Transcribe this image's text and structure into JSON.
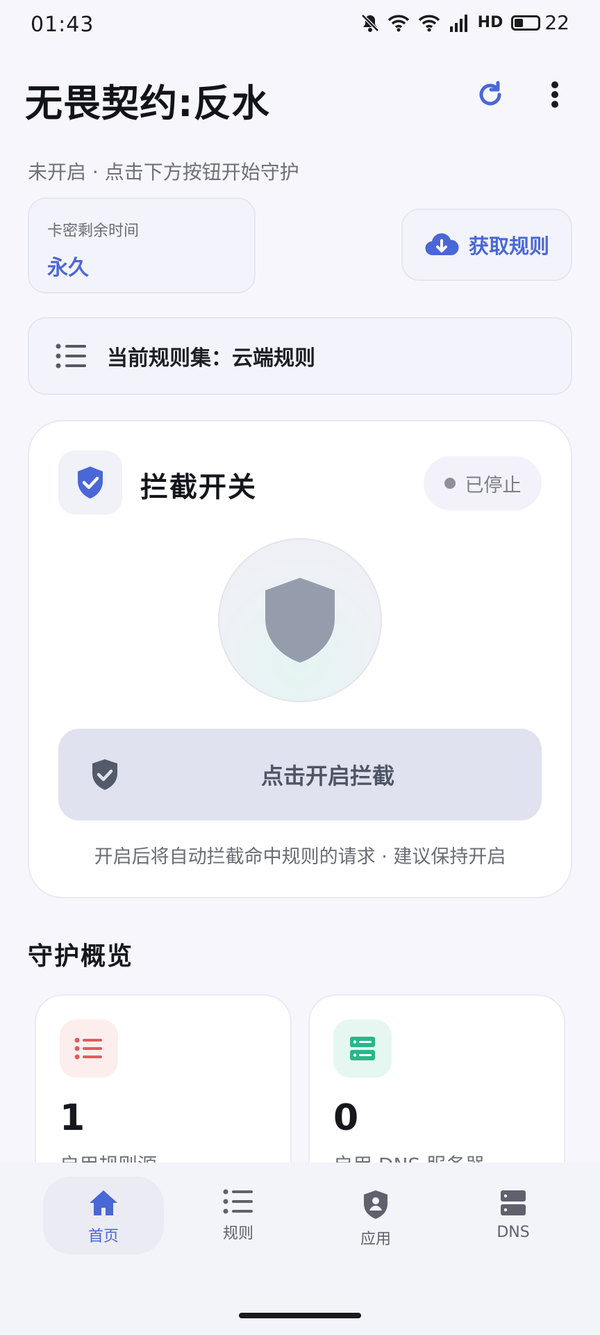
{
  "status_bar": {
    "time": "01:43",
    "network_label": "HD",
    "battery_level": "22"
  },
  "header": {
    "title": "无畏契约:反水",
    "subtitle": "未开启 · 点击下方按钮开始守护"
  },
  "key_card": {
    "label": "卡密剩余时间",
    "value": "永久"
  },
  "fetch_button": {
    "label": "获取规则"
  },
  "ruleset": {
    "label": "当前规则集：云端规则"
  },
  "intercept": {
    "title": "拦截开关",
    "state": "已停止",
    "button_label": "点击开启拦截",
    "hint": "开启后将自动拦截命中规则的请求 · 建议保持开启"
  },
  "overview": {
    "title": "守护概览",
    "stats": [
      {
        "value": "1",
        "label": "启用规则源",
        "icon": "list-icon",
        "icon_color": "#e45b5b",
        "tile_color": "#fdeeee"
      },
      {
        "value": "0",
        "label": "启用 DNS 服务器",
        "icon": "server-icon",
        "icon_color": "#27b889",
        "tile_color": "#e6f7f1"
      }
    ]
  },
  "nav": {
    "items": [
      {
        "label": "首页",
        "icon": "home-icon",
        "active": true
      },
      {
        "label": "规则",
        "icon": "list-icon",
        "active": false
      },
      {
        "label": "应用",
        "icon": "shield-user-icon",
        "active": false
      },
      {
        "label": "DNS",
        "icon": "server-icon",
        "active": false
      }
    ]
  },
  "colors": {
    "accent": "#4a67d6",
    "background": "#f6f6fc"
  }
}
